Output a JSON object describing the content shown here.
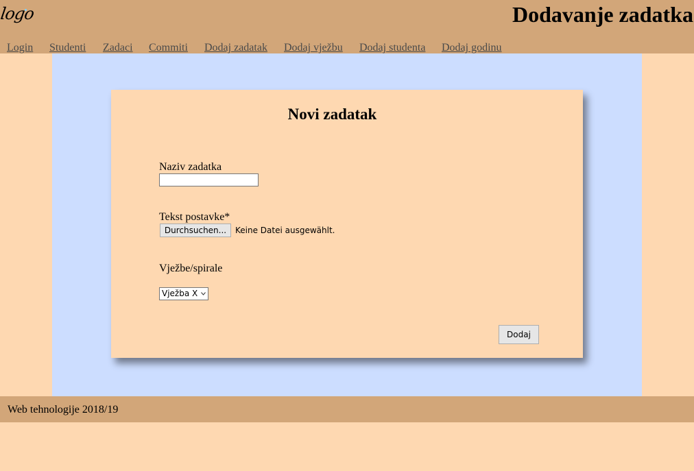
{
  "header": {
    "logo_text": "logo",
    "title": "Dodavanje zadatka"
  },
  "nav": {
    "items": [
      {
        "label": "Login"
      },
      {
        "label": "Studenti"
      },
      {
        "label": "Zadaci"
      },
      {
        "label": "Commiti"
      },
      {
        "label": "Dodaj zadatak"
      },
      {
        "label": "Dodaj vježbu"
      },
      {
        "label": "Dodaj studenta"
      },
      {
        "label": "Dodaj godinu"
      }
    ]
  },
  "form": {
    "title": "Novi zadatak",
    "naziv_label": "Naziv zadatka",
    "naziv_value": "",
    "tekst_label": "Tekst postavke*",
    "file_button_label": "Durchsuchen...",
    "file_status": "Keine Datei ausgewählt.",
    "vjezbe_label": "Vježbe/spirale",
    "vjezba_selected": "Vježba X",
    "submit_label": "Dodaj"
  },
  "footer": {
    "text": "Web tehnologije 2018/19"
  },
  "colors": {
    "page_background": "#fed8b1",
    "header_background": "#d2a679",
    "main_background": "#ccddff",
    "nav_link": "#4a4a4a"
  },
  "icons": {
    "select_arrow": "chevron-down-icon"
  }
}
